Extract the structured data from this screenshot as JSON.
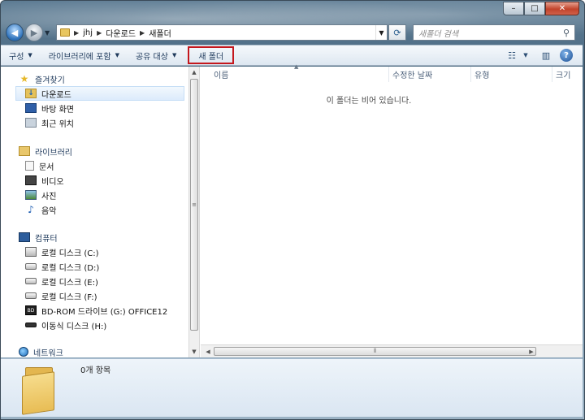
{
  "window": {
    "caption": {
      "minimize": "–",
      "maximize": "□",
      "close": "✕"
    }
  },
  "navigation": {
    "back_icon": "back-arrow-icon",
    "forward_icon": "forward-arrow-icon",
    "breadcrumb": [
      "jhj",
      "다운로드",
      "새폴더"
    ],
    "search_placeholder": "새폴더 검색"
  },
  "toolbar": {
    "organize": "구성",
    "include_in_library": "라이브러리에 포함",
    "share_with": "공유 대상",
    "new_folder": "새 폴더",
    "highlight_color": "#c4171d"
  },
  "sidebar": {
    "favorites": {
      "label": "즐겨찾기",
      "items": [
        {
          "label": "다운로드",
          "icon": "downloads-folder-icon",
          "selected": true
        },
        {
          "label": "바탕 화면",
          "icon": "desktop-icon"
        },
        {
          "label": "최근 위치",
          "icon": "recent-places-icon"
        }
      ]
    },
    "libraries": {
      "label": "라이브러리",
      "items": [
        {
          "label": "문서",
          "icon": "documents-icon"
        },
        {
          "label": "비디오",
          "icon": "videos-icon"
        },
        {
          "label": "사진",
          "icon": "pictures-icon"
        },
        {
          "label": "음악",
          "icon": "music-icon"
        }
      ]
    },
    "computer": {
      "label": "컴퓨터",
      "items": [
        {
          "label": "로컬 디스크 (C:)",
          "icon": "system-drive-icon"
        },
        {
          "label": "로컬 디스크 (D:)",
          "icon": "hard-drive-icon"
        },
        {
          "label": "로컬 디스크 (E:)",
          "icon": "hard-drive-icon"
        },
        {
          "label": "로컬 디스크 (F:)",
          "icon": "hard-drive-icon"
        },
        {
          "label": "BD-ROM 드라이브 (G:) OFFICE12",
          "icon": "bd-rom-drive-icon"
        },
        {
          "label": "이동식 디스크 (H:)",
          "icon": "removable-disk-icon"
        }
      ]
    },
    "network": {
      "label": "네트워크"
    }
  },
  "file_list": {
    "columns": [
      "이름",
      "수정한 날짜",
      "유형",
      "크기"
    ],
    "empty_message": "이 폴더는 비어 있습니다."
  },
  "details_pane": {
    "item_count": "0개 항목"
  }
}
